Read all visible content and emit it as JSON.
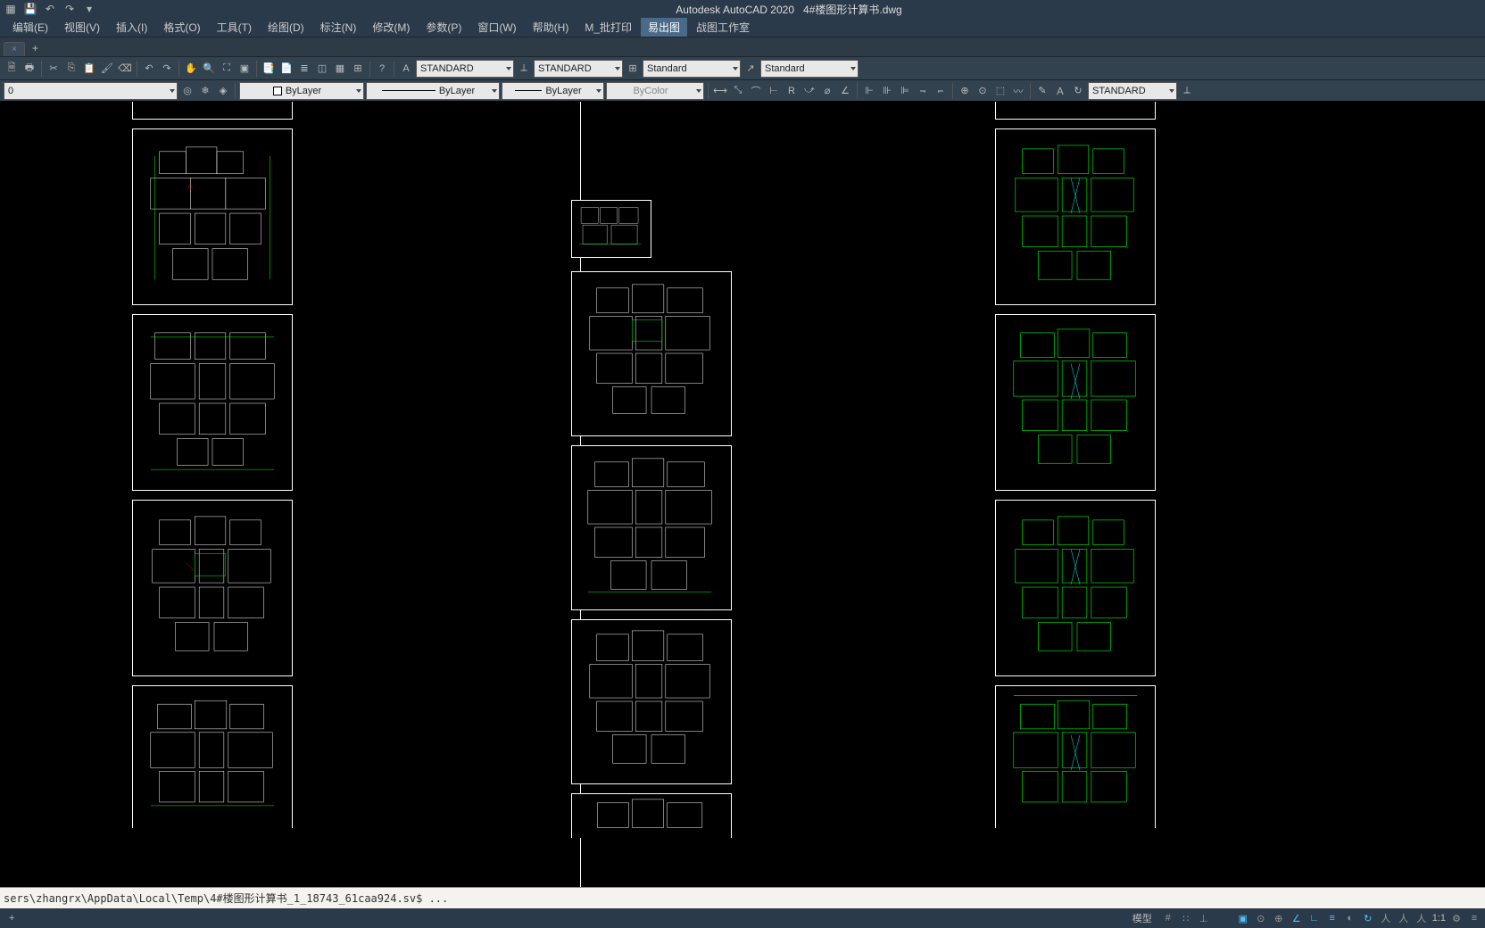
{
  "title": {
    "app": "Autodesk AutoCAD 2020",
    "file": "4#楼图形计算书.dwg"
  },
  "menus": [
    "编辑(E)",
    "视图(V)",
    "插入(I)",
    "格式(O)",
    "工具(T)",
    "绘图(D)",
    "标注(N)",
    "修改(M)",
    "参数(P)",
    "窗口(W)",
    "帮助(H)",
    "M_批打印",
    "易出图",
    "战图工作室"
  ],
  "hovered_menu_index": 12,
  "toolbar1": {
    "text_style": "STANDARD",
    "dim_style": "STANDARD",
    "table_style": "Standard",
    "mleader_style": "Standard"
  },
  "toolbar2": {
    "layer_value": "0",
    "color": "ByLayer",
    "linetype": "ByLayer",
    "lineweight": "ByLayer",
    "plotstyle": "ByColor",
    "dim_style2": "STANDARD"
  },
  "command": "sers\\zhangrx\\AppData\\Local\\Temp\\4#楼图形计算书_1_18743_61caa924.sv$ ...",
  "status": {
    "tab": "模型",
    "scale": "1:1"
  }
}
